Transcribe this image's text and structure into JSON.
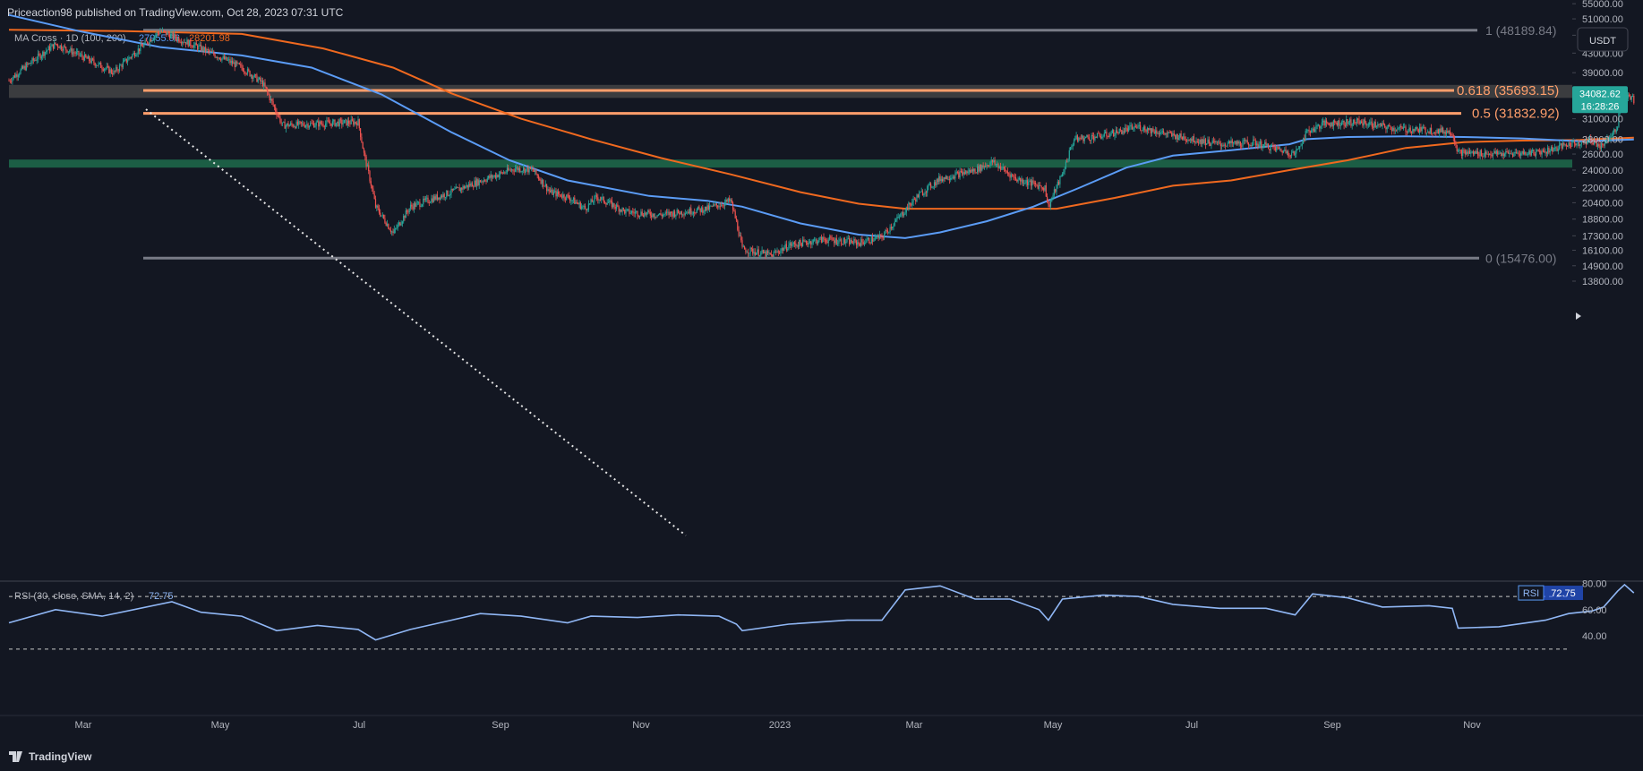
{
  "header": {
    "publish_line": "Priceaction98 published on TradingView.com, Oct 28, 2023 07:31 UTC"
  },
  "indicator": {
    "label": "MA Cross · 1D (100, 200)",
    "ma100_value": "27955.96",
    "ma200_value": "28201.98"
  },
  "currency_button": "USDT",
  "price_badge": {
    "price": "34082.62",
    "countdown": "16:28:26"
  },
  "fib_labels": {
    "top": "1 (48189.84)",
    "f618": "0.618 (35693.15)",
    "f05": "0.5 (31832.92)",
    "bottom": "0 (15476.00)"
  },
  "rsi": {
    "label": "RSI (30, close, SMA, 14, 2)",
    "value": "72.75",
    "tag": "RSI"
  },
  "footer": {
    "brand": "TradingView"
  },
  "colors": {
    "background": "#131722",
    "up": "#26a69a",
    "down": "#ef5350",
    "ma100": "#5b9cf6",
    "ma200": "#f0691f",
    "fib_line": "#ff9e6b",
    "fib_gray": "#787b86",
    "green_zone": "#1c5e45",
    "gray_zone": "#4a4a4a",
    "rsi_line": "#90b7f5"
  },
  "chart_data": {
    "type": "candlestick",
    "title": "MA Cross · 1D (100, 200)",
    "x_ticks": [
      "Mar",
      "May",
      "Jul",
      "Sep",
      "Nov",
      "2023",
      "Mar",
      "May",
      "Jul",
      "Sep",
      "Nov"
    ],
    "price_axis_ticks": [
      "55000.00",
      "51000.00",
      "47000.00",
      "43000.00",
      "39000.00",
      "35000.00",
      "31000.00",
      "28000.00",
      "26000.00",
      "24000.00",
      "22000.00",
      "20400.00",
      "18800.00",
      "17300.00",
      "16100.00",
      "14900.00",
      "13800.00"
    ],
    "rsi_axis_ticks": [
      "80.00",
      "60.00",
      "40.00"
    ],
    "price_path": [
      [
        0,
        37500
      ],
      [
        40,
        45000
      ],
      [
        90,
        39000
      ],
      [
        130,
        48000
      ],
      [
        165,
        44000
      ],
      [
        200,
        40000
      ],
      [
        218,
        37000
      ],
      [
        225,
        34000
      ],
      [
        235,
        30000
      ],
      [
        300,
        30500
      ],
      [
        305,
        26000
      ],
      [
        315,
        20000
      ],
      [
        330,
        17500
      ],
      [
        345,
        20000
      ],
      [
        380,
        21500
      ],
      [
        400,
        22500
      ],
      [
        435,
        24200
      ],
      [
        450,
        24000
      ],
      [
        465,
        21500
      ],
      [
        480,
        21000
      ],
      [
        495,
        19800
      ],
      [
        505,
        21000
      ],
      [
        530,
        19500
      ],
      [
        560,
        19200
      ],
      [
        600,
        19800
      ],
      [
        620,
        20600
      ],
      [
        625,
        18500
      ],
      [
        630,
        16200
      ],
      [
        655,
        15700
      ],
      [
        670,
        16500
      ],
      [
        700,
        17000
      ],
      [
        730,
        16700
      ],
      [
        750,
        17200
      ],
      [
        765,
        19000
      ],
      [
        780,
        21000
      ],
      [
        800,
        23000
      ],
      [
        830,
        24000
      ],
      [
        845,
        25000
      ],
      [
        865,
        23000
      ],
      [
        890,
        22000
      ],
      [
        893,
        20000
      ],
      [
        905,
        23500
      ],
      [
        915,
        28000
      ],
      [
        940,
        28500
      ],
      [
        970,
        29800
      ],
      [
        1000,
        28500
      ],
      [
        1040,
        27300
      ],
      [
        1070,
        27500
      ],
      [
        1105,
        26000
      ],
      [
        1115,
        29000
      ],
      [
        1130,
        30300
      ],
      [
        1160,
        30500
      ],
      [
        1190,
        29500
      ],
      [
        1220,
        29300
      ],
      [
        1240,
        29000
      ],
      [
        1245,
        26200
      ],
      [
        1280,
        26000
      ],
      [
        1300,
        26100
      ],
      [
        1320,
        26400
      ],
      [
        1340,
        27300
      ],
      [
        1360,
        27800
      ],
      [
        1368,
        27000
      ],
      [
        1375,
        28400
      ],
      [
        1382,
        30000
      ],
      [
        1385,
        34500
      ],
      [
        1390,
        34600
      ],
      [
        1396,
        34100
      ]
    ],
    "ma100_path": [
      [
        0,
        52000
      ],
      [
        60,
        48000
      ],
      [
        130,
        44300
      ],
      [
        200,
        42500
      ],
      [
        260,
        40000
      ],
      [
        320,
        35000
      ],
      [
        380,
        29000
      ],
      [
        430,
        25200
      ],
      [
        480,
        22800
      ],
      [
        550,
        21100
      ],
      [
        600,
        20600
      ],
      [
        630,
        20000
      ],
      [
        680,
        18400
      ],
      [
        730,
        17400
      ],
      [
        770,
        17100
      ],
      [
        800,
        17600
      ],
      [
        840,
        18600
      ],
      [
        880,
        20000
      ],
      [
        920,
        22000
      ],
      [
        960,
        24300
      ],
      [
        1000,
        25800
      ],
      [
        1050,
        26500
      ],
      [
        1100,
        27300
      ],
      [
        1115,
        28000
      ],
      [
        1150,
        28300
      ],
      [
        1200,
        28400
      ],
      [
        1250,
        28300
      ],
      [
        1300,
        28100
      ],
      [
        1350,
        27700
      ],
      [
        1396,
        27956
      ]
    ],
    "ma200_path": [
      [
        0,
        48300
      ],
      [
        100,
        48000
      ],
      [
        200,
        47300
      ],
      [
        270,
        44000
      ],
      [
        330,
        40000
      ],
      [
        380,
        35200
      ],
      [
        440,
        31000
      ],
      [
        500,
        28000
      ],
      [
        560,
        25500
      ],
      [
        620,
        23500
      ],
      [
        680,
        21500
      ],
      [
        730,
        20300
      ],
      [
        770,
        19800
      ],
      [
        830,
        19800
      ],
      [
        900,
        19800
      ],
      [
        950,
        20900
      ],
      [
        1000,
        22200
      ],
      [
        1050,
        22800
      ],
      [
        1100,
        24000
      ],
      [
        1150,
        25200
      ],
      [
        1200,
        26800
      ],
      [
        1250,
        27600
      ],
      [
        1300,
        27800
      ],
      [
        1350,
        27900
      ],
      [
        1396,
        28202
      ]
    ],
    "fib_levels": [
      {
        "label": "1",
        "value": 48189.84
      },
      {
        "label": "0.618",
        "value": 35693.15
      },
      {
        "label": "0.5",
        "value": 31832.92
      },
      {
        "label": "0",
        "value": 15476.0
      }
    ],
    "zones": [
      {
        "name": "resistance",
        "low": 34400,
        "high": 36700
      },
      {
        "name": "support",
        "low": 24300,
        "high": 25300
      }
    ],
    "rsi_path": [
      [
        0,
        50
      ],
      [
        40,
        60
      ],
      [
        80,
        55
      ],
      [
        140,
        66
      ],
      [
        165,
        58
      ],
      [
        200,
        55
      ],
      [
        230,
        44
      ],
      [
        265,
        48
      ],
      [
        300,
        45
      ],
      [
        315,
        37
      ],
      [
        345,
        45
      ],
      [
        380,
        52
      ],
      [
        405,
        57
      ],
      [
        440,
        55
      ],
      [
        480,
        50
      ],
      [
        500,
        55
      ],
      [
        540,
        54
      ],
      [
        575,
        56
      ],
      [
        610,
        55
      ],
      [
        625,
        49
      ],
      [
        630,
        44
      ],
      [
        670,
        49
      ],
      [
        720,
        52
      ],
      [
        750,
        52
      ],
      [
        770,
        75
      ],
      [
        800,
        78
      ],
      [
        830,
        68
      ],
      [
        860,
        68
      ],
      [
        885,
        60
      ],
      [
        893,
        52
      ],
      [
        905,
        68
      ],
      [
        940,
        71
      ],
      [
        970,
        70
      ],
      [
        1000,
        64
      ],
      [
        1040,
        61
      ],
      [
        1080,
        61
      ],
      [
        1105,
        56
      ],
      [
        1120,
        72
      ],
      [
        1150,
        69
      ],
      [
        1180,
        62
      ],
      [
        1220,
        63
      ],
      [
        1240,
        61
      ],
      [
        1245,
        46
      ],
      [
        1280,
        47
      ],
      [
        1320,
        52
      ],
      [
        1340,
        57
      ],
      [
        1360,
        59
      ],
      [
        1370,
        62
      ],
      [
        1382,
        74
      ],
      [
        1388,
        79
      ],
      [
        1396,
        72.75
      ]
    ]
  }
}
